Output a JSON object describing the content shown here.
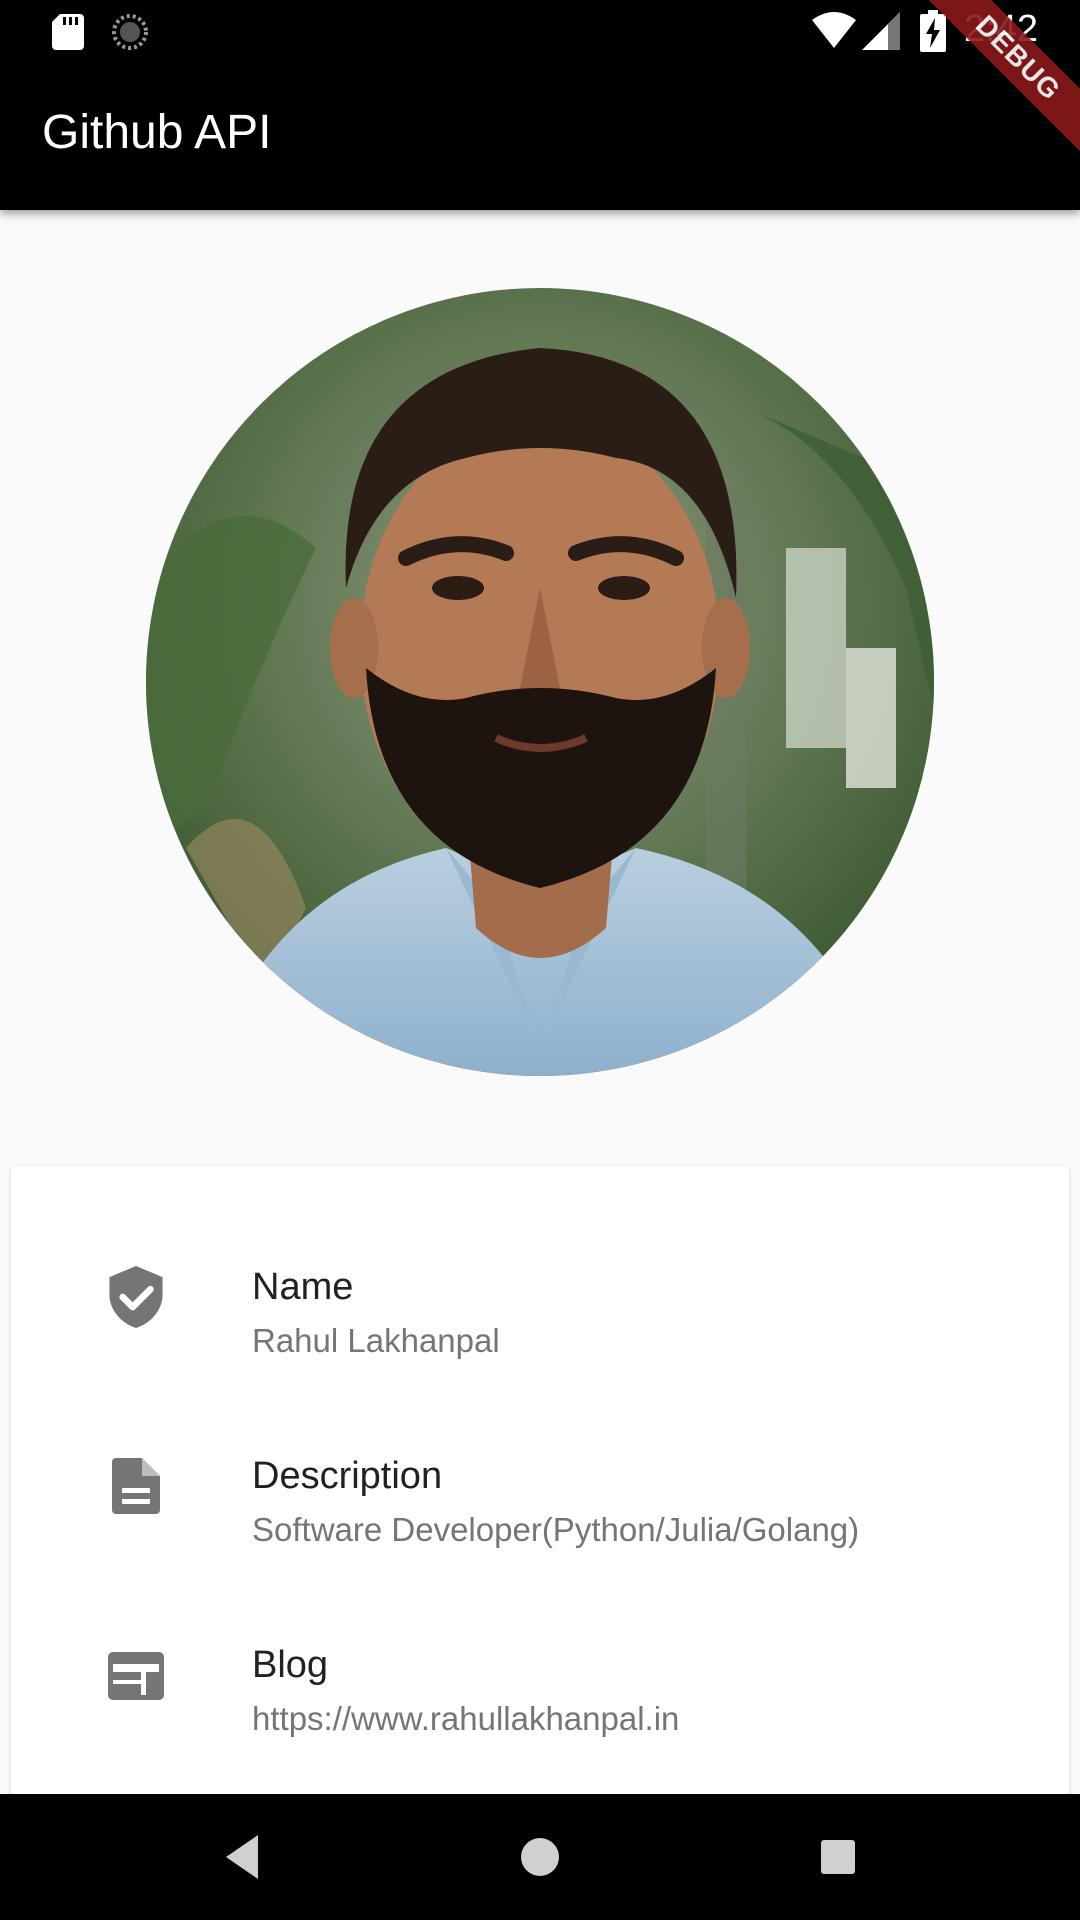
{
  "status_bar": {
    "time": "2:42",
    "icons": [
      "sd-card-icon",
      "sync-icon",
      "wifi-icon",
      "signal-icon",
      "battery-charging-icon"
    ]
  },
  "app_bar": {
    "title": "Github API",
    "debug_banner": "DEBUG",
    "background": "#000000"
  },
  "profile": {
    "avatar": "profile-photo"
  },
  "details": [
    {
      "icon": "verified-user-icon",
      "label": "Name",
      "value": "Rahul Lakhanpal"
    },
    {
      "icon": "description-icon",
      "label": "Description",
      "value": "Software Developer(Python/Julia/Golang)"
    },
    {
      "icon": "web-icon",
      "label": "Blog",
      "value": "https://www.rahullakhanpal.in"
    }
  ],
  "nav_bar": {
    "buttons": [
      "back-icon",
      "home-icon",
      "recents-icon"
    ]
  },
  "colors": {
    "background": "#fafafa",
    "card": "#ffffff",
    "icon": "#757575",
    "label": "#212121",
    "value": "#757575"
  }
}
